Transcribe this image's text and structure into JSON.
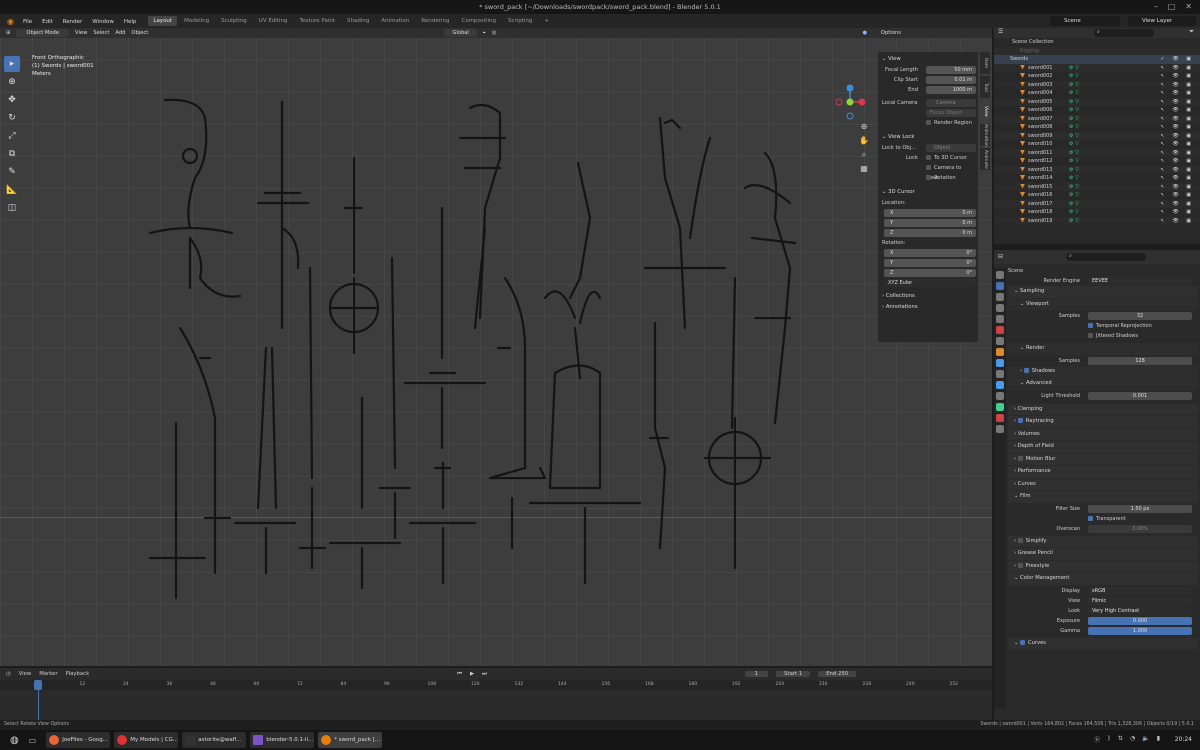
{
  "window": {
    "title": "* sword_pack [~/Downloads/swordpack/sword_pack.blend] - Blender 5.0.1"
  },
  "menu": {
    "items": [
      "File",
      "Edit",
      "Render",
      "Window",
      "Help"
    ]
  },
  "workspaces": [
    "Layout",
    "Modeling",
    "Sculpting",
    "UV Editing",
    "Texture Paint",
    "Shading",
    "Animation",
    "Rendering",
    "Compositing",
    "Scripting"
  ],
  "scene": {
    "scene_label": "Scene",
    "view_layer_label": "View Layer"
  },
  "viewport_header": {
    "mode": "Object Mode",
    "menus": [
      "View",
      "Select",
      "Add",
      "Object"
    ],
    "orientation": "Global",
    "options": "Options"
  },
  "viewport": {
    "view_name": "Front Orthographic",
    "collection_info": "(1) Swords | sword001",
    "units": "Meters"
  },
  "npanel": {
    "view_section": "View",
    "focal_length_label": "Focal Length",
    "focal_length": "50 mm",
    "clip_start_label": "Clip Start",
    "clip_start": "0.01 m",
    "end_label": "End",
    "end": "1000 m",
    "local_camera_label": "Local Camera",
    "local_camera": "Camera",
    "focus_label": "Focus Object",
    "render_region": "Render Region",
    "view_lock_section": "View Lock",
    "lock_to_object_label": "Lock to Obj...",
    "lock_to_object": "Object",
    "lock_label": "Lock",
    "lock_3d_cursor": "To 3D Cursor",
    "camera_to_view": "Camera to View",
    "rotation": "Rotation",
    "cursor_section": "3D Cursor",
    "location_label": "Location:",
    "x_label": "X",
    "y_label": "Y",
    "z_label": "Z",
    "loc_x": "0 m",
    "loc_y": "0 m",
    "loc_z": "0 m",
    "rotation_label": "Rotation:",
    "rot_x": "0°",
    "rot_y": "0°",
    "rot_z": "0°",
    "rot_mode": "XYZ Euler",
    "collections": "Collections",
    "annotations": "Annotations",
    "tabs": [
      "Item",
      "Tool",
      "View",
      "Animation",
      "Animate"
    ]
  },
  "outliner": {
    "root": "Scene Collection",
    "hidden_item": "Rigging",
    "collection": "Swords",
    "objects": [
      "sword001",
      "sword002",
      "sword003",
      "sword004",
      "sword005",
      "sword006",
      "sword007",
      "sword008",
      "sword009",
      "sword010",
      "sword011",
      "sword012",
      "sword013",
      "sword014",
      "sword015",
      "sword016",
      "sword017",
      "sword018",
      "sword019"
    ]
  },
  "properties": {
    "scene_label": "Scene",
    "render_engine_label": "Render Engine",
    "render_engine": "EEVEE",
    "sampling": "Sampling",
    "viewport": "Viewport",
    "samples_label": "Samples",
    "viewport_samples": "32",
    "temporal_reprojection": "Temporal Reprojection",
    "jittered_shadows": "Jittered Shadows",
    "render": "Render",
    "render_samples": "128",
    "shadows": "Shadows",
    "advanced": "Advanced",
    "light_threshold_label": "Light Threshold",
    "light_threshold": "0.001",
    "clamping": "Clamping",
    "raytracing": "Raytracing",
    "volumes": "Volumes",
    "depth_of_field": "Depth of Field",
    "motion_blur": "Motion Blur",
    "performance": "Performance",
    "curves": "Curves",
    "film": "Film",
    "filter_size_label": "Filter Size",
    "filter_size": "1.50 px",
    "transparent": "Transparent",
    "overscan_label": "Overscan",
    "overscan": "3.00%",
    "simplify": "Simplify",
    "grease_pencil": "Grease Pencil",
    "freestyle": "Freestyle",
    "color_management": "Color Management",
    "display_label": "Display",
    "display": "sRGB",
    "view_label": "View",
    "view": "Filmic",
    "look_label": "Look",
    "look": "Very High Contrast",
    "exposure_label": "Exposure",
    "exposure": "0.000",
    "gamma_label": "Gamma",
    "gamma": "1.000",
    "curves_cb": "Curves"
  },
  "timeline": {
    "menus": [
      "View",
      "Marker",
      "Playback"
    ],
    "current_frame": "1",
    "start_label": "Start",
    "start": "1",
    "end_label": "End",
    "end": "250",
    "ticks": [
      "1",
      "12",
      "24",
      "36",
      "48",
      "60",
      "72",
      "84",
      "96",
      "108",
      "120",
      "132",
      "144",
      "156",
      "168",
      "180",
      "192",
      "204",
      "216",
      "228",
      "240",
      "252"
    ]
  },
  "statusbar": {
    "left": "Select    Rotate View    Options",
    "right": "Swords | sword001 | Verts 164,802 | Faces 164,506 | Tris 1,328,306 | Objects 0/19 | 5.0.1"
  },
  "taskbar": {
    "tasks": [
      "JoeFiles - Goog...",
      "My Models | CG...",
      "astorite@wafl...",
      "blender-5.0.1-li...",
      "* sword_pack [..."
    ],
    "clock": "20:24"
  },
  "colors": {
    "accent": "#4772b3",
    "object": "#e0892f",
    "mesh_data": "#3fcf8e",
    "viewport_bg": "#3d3d3d"
  }
}
